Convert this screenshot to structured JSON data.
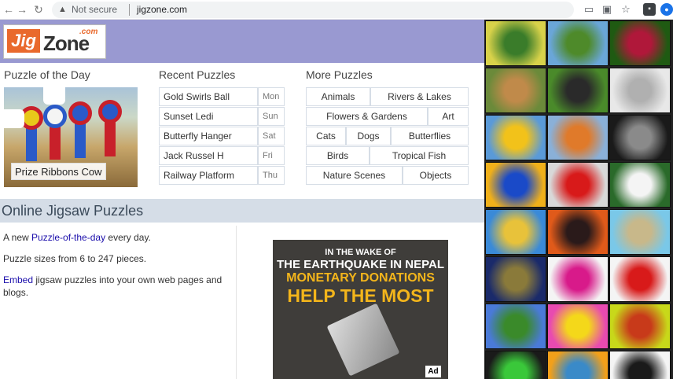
{
  "browser": {
    "back_glyph": "←",
    "forward_glyph": "→",
    "reload_glyph": "↻",
    "security_label": "Not secure",
    "url": "jigzone.com",
    "icons": [
      "cast-icon",
      "extension-icon",
      "bookmark-star-icon",
      "profile-icon",
      "account-icon"
    ]
  },
  "logo": {
    "jig": "Jig",
    "zone": "Zone",
    "com": ".com"
  },
  "colors": {
    "banner": "#9999d1",
    "accent": "#e9692c",
    "link": "#1a0dab",
    "section_bar": "#d5dde7"
  },
  "puzzle_of_the_day": {
    "heading": "Puzzle of the Day",
    "caption": "Prize Ribbons Cow"
  },
  "recent_puzzles": {
    "heading": "Recent Puzzles",
    "items": [
      {
        "name": "Gold Swirls Ball",
        "day": "Mon"
      },
      {
        "name": "Sunset Ledi",
        "day": "Sun"
      },
      {
        "name": "Butterfly Hanger",
        "day": "Sat"
      },
      {
        "name": "Jack Russel H",
        "day": "Fri"
      },
      {
        "name": "Railway Platform",
        "day": "Thu"
      }
    ]
  },
  "more_puzzles": {
    "heading": "More Puzzles",
    "rows": [
      [
        "Animals",
        "Rivers & Lakes"
      ],
      [
        "Flowers & Gardens",
        "Art"
      ],
      [
        "Cats",
        "Dogs",
        "Butterflies"
      ],
      [
        "Birds",
        "Tropical Fish"
      ],
      [
        "Nature Scenes",
        "Objects"
      ]
    ]
  },
  "online": {
    "heading": "Online Jigsaw Puzzles",
    "line1_prefix": "A new ",
    "line1_link": "Puzzle-of-the-day",
    "line1_suffix": " every day.",
    "line2": "Puzzle sizes from 6 to 247 pieces.",
    "line3_link": "Embed",
    "line3_suffix": " jigsaw puzzles into your own web pages and blogs."
  },
  "ad": {
    "line1": "IN THE WAKE OF",
    "line2": "THE EARTHQUAKE IN NEPAL",
    "line3": "MONETARY DONATIONS",
    "line4": "HELP THE MOST",
    "badge": "Ad"
  },
  "thumbnails": [
    {
      "name": "thumb-yellow-flower",
      "c1": "#d8d24a",
      "c2": "#3a7c2a"
    },
    {
      "name": "thumb-cow-field",
      "c1": "#6aa6d8",
      "c2": "#4e8a2a"
    },
    {
      "name": "thumb-red-lily",
      "c1": "#1f5a12",
      "c2": "#b0183a"
    },
    {
      "name": "thumb-deer",
      "c1": "#6b8a3a",
      "c2": "#c08a4a"
    },
    {
      "name": "thumb-dog-ball",
      "c1": "#4a8a2a",
      "c2": "#2a2a2a"
    },
    {
      "name": "thumb-snowy-owl",
      "c1": "#e8e8e8",
      "c2": "#b0b0b0"
    },
    {
      "name": "thumb-sunflower",
      "c1": "#5a9ad8",
      "c2": "#f2c21a"
    },
    {
      "name": "thumb-orange-bowl",
      "c1": "#8ab0d8",
      "c2": "#e07a2a"
    },
    {
      "name": "thumb-spider-web",
      "c1": "#1a1a1a",
      "c2": "#8a8a8a"
    },
    {
      "name": "thumb-blue-butterfly",
      "c1": "#f0b01a",
      "c2": "#1a4ac8"
    },
    {
      "name": "thumb-red-tulips",
      "c1": "#d8d8d8",
      "c2": "#d81a1a"
    },
    {
      "name": "thumb-white-flower",
      "c1": "#2a6a2a",
      "c2": "#f4f4f4"
    },
    {
      "name": "thumb-yellow-crab",
      "c1": "#3a8ad8",
      "c2": "#e8c23a"
    },
    {
      "name": "thumb-sunset-sea",
      "c1": "#e05a1a",
      "c2": "#2a1a1a"
    },
    {
      "name": "thumb-beach-island",
      "c1": "#7ac8e8",
      "c2": "#c8b88a"
    },
    {
      "name": "thumb-big-ben",
      "c1": "#1a2a6a",
      "c2": "#8a7a3a"
    },
    {
      "name": "thumb-fathers-day",
      "c1": "#f4f4f4",
      "c2": "#d81a8a"
    },
    {
      "name": "thumb-climbers",
      "c1": "#f4f4f4",
      "c2": "#d81a1a"
    },
    {
      "name": "thumb-red-barn",
      "c1": "#4a7ad8",
      "c2": "#3a8a2a"
    },
    {
      "name": "thumb-pink-daisy",
      "c1": "#e84ab0",
      "c2": "#f4d81a"
    },
    {
      "name": "thumb-red-butterfly",
      "c1": "#c8d81a",
      "c2": "#c83a1a"
    },
    {
      "name": "thumb-colorful-shoes",
      "c1": "#1a1a1a",
      "c2": "#3ac83a"
    },
    {
      "name": "thumb-striped-wall",
      "c1": "#f2a01a",
      "c2": "#3a8ac8"
    },
    {
      "name": "thumb-jigzone-logo",
      "c1": "#f4f4f4",
      "c2": "#1a1a1a"
    }
  ]
}
